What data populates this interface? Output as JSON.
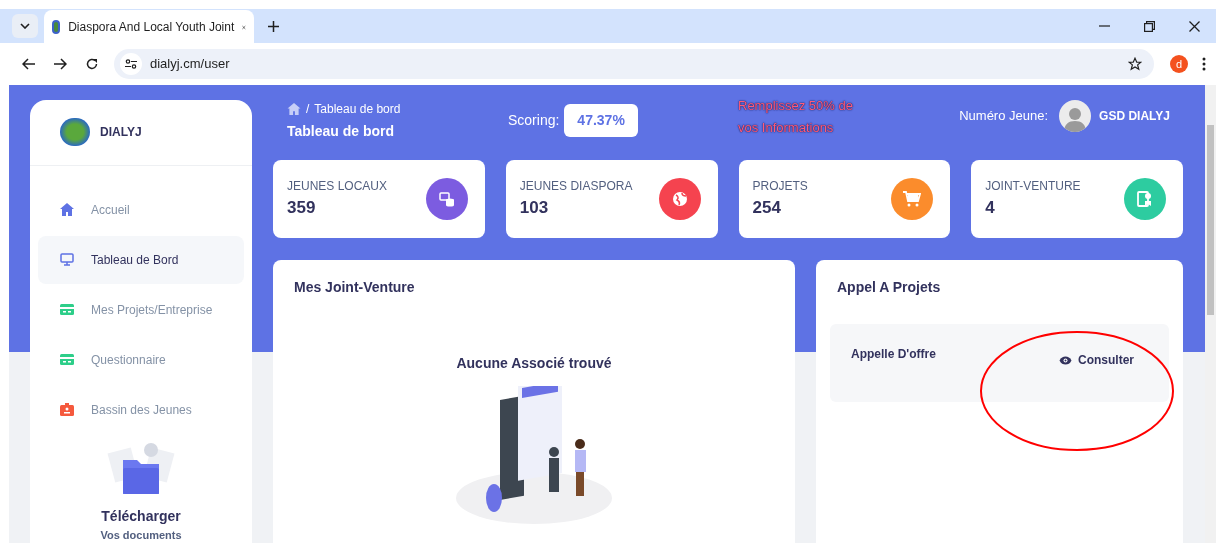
{
  "browser": {
    "tab_title": "Diaspora And Local Youth Joint",
    "url": "dialyj.cm/user",
    "profile_initial": "d"
  },
  "sidebar": {
    "brand": "DIALYJ",
    "items": [
      {
        "label": "Accueil",
        "kind": "home",
        "selected": false
      },
      {
        "label": "Tableau de Bord",
        "kind": "monitor",
        "selected": true
      },
      {
        "label": "Mes Projets/Entreprise",
        "kind": "card",
        "selected": false
      },
      {
        "label": "Questionnaire",
        "kind": "card",
        "selected": false
      },
      {
        "label": "Bassin des Jeunes",
        "kind": "badge",
        "selected": false
      }
    ],
    "download": {
      "title": "Télécharger",
      "subtitle": "Vos documents"
    }
  },
  "header": {
    "breadcrumb": "Tableau de bord",
    "separator": "/",
    "title": "Tableau de bord",
    "scoring_label": "Scoring:",
    "scoring_value": "47.37%",
    "warning": "Remplissez 50% de vos Informations",
    "number_label": "Numéro Jeune:",
    "user_name": "GSD DIALYJ"
  },
  "stats": [
    {
      "label": "JEUNES LOCAUX",
      "value": "359",
      "kind": "database",
      "color": "#7c5ce0"
    },
    {
      "label": "JEUNES DIASPORA",
      "value": "103",
      "kind": "globe",
      "color": "#f5434f"
    },
    {
      "label": "PROJETS",
      "value": "254",
      "kind": "cart",
      "color": "#fb8c2c"
    },
    {
      "label": "JOINT-VENTURE",
      "value": "4",
      "kind": "contact",
      "color": "#2dcca0"
    }
  ],
  "joint_venture": {
    "title": "Mes Joint-Venture",
    "empty_message": "Aucune Associé trouvé"
  },
  "calls": {
    "title": "Appel A Projets",
    "items": [
      {
        "label": "Appelle D'offre",
        "action": "Consulter"
      }
    ]
  }
}
